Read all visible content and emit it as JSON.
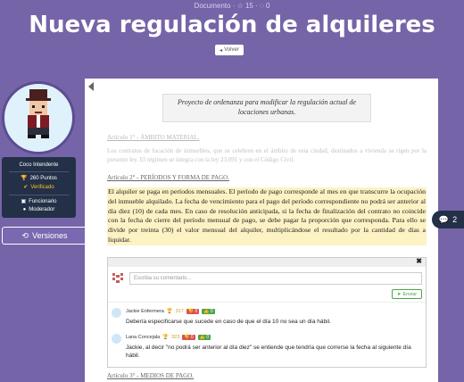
{
  "header": {
    "meta": "Documento · ☆ 15 · ◌ 0",
    "title": "Nueva regulación de alquileres",
    "back_label": "Volver"
  },
  "user": {
    "role": "Coco Intendente",
    "points": "260 Puntos",
    "verified": "Verificado",
    "type": "Funcionario",
    "moderator": "Moderador"
  },
  "sidebar": {
    "versions_label": "Versiones"
  },
  "document": {
    "summary": "Proyecto de ordenanza para modificar la regulación actual de locaciones urbanas.",
    "article1_title": "Artículo 1° - ÁMBITO MATERIAL.",
    "article1_text": "Los contratos de locación de inmuebles, que se celebren en el ámbito de esta ciudad, destinados a vivienda se rigen por la presente ley. El régimen se integra con la ley 23.091 y con el Código Civil.",
    "article2_title": "Artículo 2° - PERÍODOS Y FORMA DE PAGO.",
    "article2_text": "El alquiler se paga en períodos mensuales. El período de pago corresponde al mes en que transcurre la ocupación del inmueble alquilado. La fecha de vencimiento para el pago del período correspondiente no podrá ser anterior al día diez (10) de cada mes. En caso de resolución anticipada, si la fecha de finalización del contrato no coincide con la fecha de cierre del período mensual de pago, se debe pagar la proporción que corresponda. Para ello se divide por treinta (30) el valor mensual del alquiler, multiplicándose el resultado por la cantidad de días a liquidar.",
    "article3_title": "Artículo 3° - MEDIOS DE PAGO."
  },
  "comments_badge": {
    "count": "2"
  },
  "comments": {
    "placeholder": "Escriba su comentario...",
    "send_label": "Enviar",
    "items": [
      {
        "author": "Jackie Enfermera",
        "points": "317",
        "down": "0",
        "up": "0",
        "text": "Debería especificarse que sucede en caso de que el día 10 no sea un día hábil."
      },
      {
        "author": "Lana Concejala",
        "points": "323",
        "down": "0",
        "up": "0",
        "text": "Jackie, al decir \"no podrá ser anterior al día diez\" se entiende que tendría que correrse la fecha al siguiente día hábil."
      }
    ]
  },
  "colors": {
    "background": "#7664a8",
    "highlight": "#fcf2c4",
    "card": "#233047",
    "verified": "#f5c518"
  }
}
